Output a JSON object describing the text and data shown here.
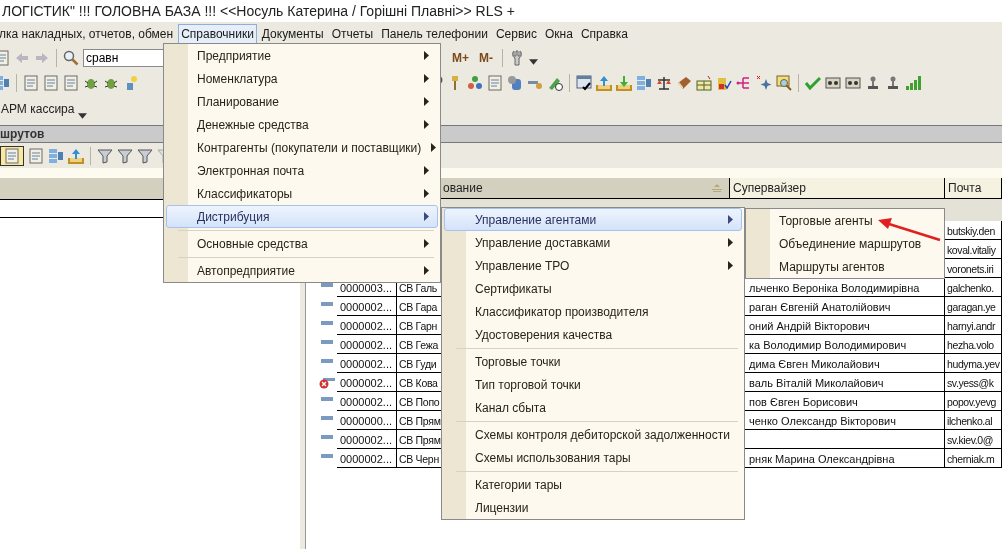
{
  "window": {
    "title": "ЛОГІСТИК\"  !!! ГОЛОВНА БАЗА !!! <<Носуль Катерина / Горішні Плавні>> RLS +"
  },
  "menubar": {
    "items": [
      {
        "label": "лка накладных, отчетов, обмен",
        "selected": false
      },
      {
        "label": "Справочники",
        "selected": true
      },
      {
        "label": "Документы",
        "selected": false
      },
      {
        "label": "Отчеты",
        "selected": false
      },
      {
        "label": "Панель телефонии",
        "selected": false
      },
      {
        "label": "Сервис",
        "selected": false
      },
      {
        "label": "Окна",
        "selected": false
      },
      {
        "label": "Справка",
        "selected": false
      }
    ]
  },
  "toolbar": {
    "search": {
      "value": "сравн"
    },
    "memory_buttons": [
      "M+",
      "M-"
    ]
  },
  "panel_button": {
    "label": "АРМ кассира"
  },
  "list_window": {
    "title": "шрутов"
  },
  "table": {
    "columns": [
      {
        "label": "ование",
        "sorted": true
      },
      {
        "label": "Супервайзер",
        "sorted": false
      },
      {
        "label": "Почта",
        "sorted": false
      }
    ],
    "rows": [
      {
        "mail": "butskiy.den"
      },
      {
        "mail": "koval.vitaliy"
      },
      {
        "mail": "voronets.iri"
      },
      {
        "deleted": false,
        "code": "0000003...",
        "name": "СВ Галь",
        "supervisor": "льченко Вероніка Володимирівна",
        "mail": "galchenko."
      },
      {
        "deleted": false,
        "code": "0000002...",
        "name": "СВ Гара",
        "supervisor": "раган Євгеній Анатолійович",
        "mail": "garagan.ye"
      },
      {
        "deleted": false,
        "code": "0000002...",
        "name": "СВ Гарн",
        "supervisor": "оний Андрій Вікторович",
        "mail": "harnyi.andr"
      },
      {
        "deleted": false,
        "code": "0000002...",
        "name": "СВ Гежа",
        "supervisor": "ка Володимир Володимирович",
        "mail": "hezha.volo"
      },
      {
        "deleted": false,
        "code": "0000002...",
        "name": "СВ Гуди",
        "supervisor": "дима Євген Миколайович",
        "mail": "hudyma.yev"
      },
      {
        "deleted": true,
        "code": "0000002...",
        "name": "СВ Кова",
        "supervisor": "валь Віталій Миколайович",
        "mail": "sv.yess@k"
      },
      {
        "deleted": false,
        "code": "0000002...",
        "name": "СВ Попо",
        "supervisor": "пов Євген Борисович",
        "mail": "popov.yevg"
      },
      {
        "deleted": false,
        "code": "0000000...",
        "name": "СВ Прям",
        "supervisor": "ченко Олександр Вікторович",
        "mail": "ilchenko.al"
      },
      {
        "deleted": false,
        "code": "0000002...",
        "name": "СВ Прям",
        "mail": "sv.kiev.0@"
      },
      {
        "deleted": false,
        "code": "0000002...",
        "name": "СВ Черн",
        "supervisor": "рняк Марина Олександрівна",
        "mail": "cherniak.m"
      }
    ]
  },
  "menus": [
    {
      "items": [
        {
          "kind": "item",
          "label": "Предприятие",
          "submenu": true,
          "selected": false
        },
        {
          "kind": "item",
          "label": "Номенклатура",
          "submenu": true,
          "selected": false
        },
        {
          "kind": "item",
          "label": "Планирование",
          "submenu": true,
          "selected": false
        },
        {
          "kind": "item",
          "label": "Денежные средства",
          "submenu": true,
          "selected": false
        },
        {
          "kind": "item",
          "label": "Контрагенты (покупатели и поставщики)",
          "submenu": true,
          "selected": false
        },
        {
          "kind": "item",
          "label": "Электронная почта",
          "submenu": true,
          "selected": false
        },
        {
          "kind": "item",
          "label": "Классификаторы",
          "submenu": true,
          "selected": false
        },
        {
          "kind": "item",
          "label": "Дистрибуция",
          "submenu": true,
          "selected": true
        },
        {
          "kind": "separator"
        },
        {
          "kind": "item",
          "label": "Основные средства",
          "submenu": true,
          "selected": false
        },
        {
          "kind": "separator"
        },
        {
          "kind": "item",
          "label": "Автопредприятие",
          "submenu": true,
          "selected": false
        }
      ]
    },
    {
      "items": [
        {
          "kind": "item",
          "label": "Управление агентами",
          "submenu": true,
          "selected": true
        },
        {
          "kind": "item",
          "label": "Управление доставками",
          "submenu": true,
          "selected": false
        },
        {
          "kind": "item",
          "label": "Управление ТРО",
          "submenu": true,
          "selected": false
        },
        {
          "kind": "item",
          "label": "Сертификаты",
          "submenu": false,
          "selected": false
        },
        {
          "kind": "item",
          "label": "Классификатор производителя",
          "submenu": false,
          "selected": false
        },
        {
          "kind": "item",
          "label": "Удостоверения качества",
          "submenu": false,
          "selected": false
        },
        {
          "kind": "separator"
        },
        {
          "kind": "item",
          "label": "Торговые точки",
          "submenu": false,
          "selected": false
        },
        {
          "kind": "item",
          "label": "Тип торговой точки",
          "submenu": false,
          "selected": false
        },
        {
          "kind": "item",
          "label": "Канал сбыта",
          "submenu": false,
          "selected": false
        },
        {
          "kind": "separator"
        },
        {
          "kind": "item",
          "label": "Схемы контроля дебиторской задолженности",
          "submenu": false,
          "selected": false
        },
        {
          "kind": "item",
          "label": "Схемы использования тары",
          "submenu": false,
          "selected": false
        },
        {
          "kind": "separator"
        },
        {
          "kind": "item",
          "label": "Категории тары",
          "submenu": false,
          "selected": false
        },
        {
          "kind": "item",
          "label": "Лицензии",
          "submenu": false,
          "selected": false
        }
      ]
    },
    {
      "items": [
        {
          "kind": "item",
          "label": "Торговые агенты",
          "submenu": false,
          "selected": false
        },
        {
          "kind": "item",
          "label": "Объединение маршрутов",
          "submenu": false,
          "selected": false
        },
        {
          "kind": "item",
          "label": "Маршруты агентов",
          "submenu": false,
          "selected": false
        }
      ]
    }
  ]
}
